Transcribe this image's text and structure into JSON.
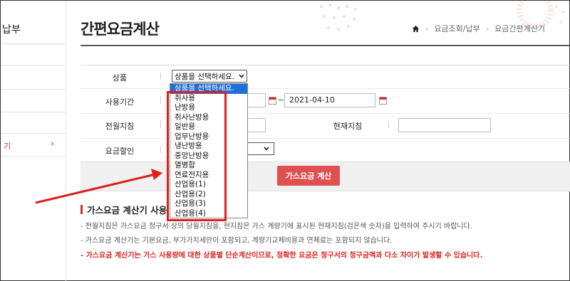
{
  "sidebar": {
    "title": "납부",
    "active_item": "기",
    "active_chevron": "›"
  },
  "header": {
    "title": "간편요금계산",
    "breadcrumb": {
      "home_icon": "home-icon",
      "level1": "요금조회/납부",
      "level2": "요금간편계산기",
      "separator": "›"
    }
  },
  "form": {
    "product": {
      "label": "상품",
      "selected": "상품을 선택하세요."
    },
    "period": {
      "label": "사용기간",
      "start": "",
      "tilde": "~",
      "end": "2021-04-10"
    },
    "readings": {
      "prev_label": "전월지침",
      "prev_value": "",
      "curr_label": "현재지침",
      "curr_value": ""
    },
    "discount": {
      "label": "요금할인",
      "selected": ""
    },
    "calc_button": "가스요금 계산"
  },
  "dropdown": {
    "options": [
      "상품을 선택하세요.",
      "취사용",
      "난방용",
      "취사난방용",
      "일반용",
      "업무난방용",
      "냉난방용",
      "중앙난방용",
      "열병합",
      "연료전지용",
      "산업용(1)",
      "산업용(2)",
      "산업용(3)",
      "산업용(4)"
    ],
    "selected_index": 0
  },
  "notes": {
    "title": "가스요금 계산기 사용",
    "items": [
      "- 전월지침은 가스요금 청구서 상의 당월지침을, 현지침은 가스 계량기에 표시된 현재지침(검은색 숫자)을 입력하여 주시기 바랍니다.",
      "- 가스요금 계산기는 기본요금, 부가가치세만이 포함되고, 계량기교체비용과 연체료는 포함되지 않습니다.",
      "- 가스요금 계산기는 가스 사용량에 대한 상품별 단순계산이므로, 정확한 요금은 청구서의 청구금액과 다소 차이가 발생할 수 있습니다."
    ]
  },
  "colors": {
    "accent": "#c8322e",
    "button": "#e05050",
    "highlight_box": "#e01d1d",
    "selected_option": "#1e6fd9"
  }
}
